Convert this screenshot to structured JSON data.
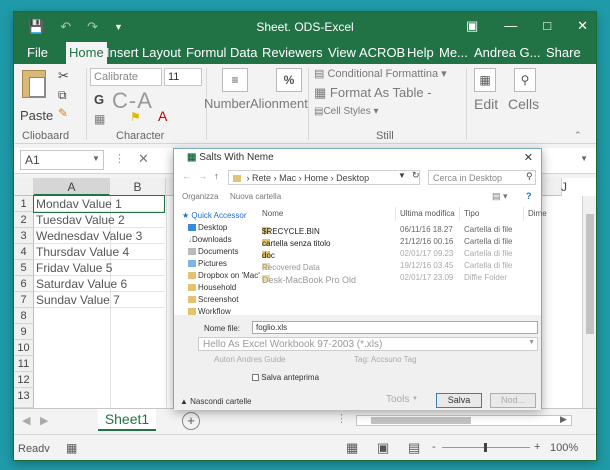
{
  "window": {
    "title": "Sheet. ODS-Excel",
    "qat_icons": [
      "save-icon",
      "undo-icon",
      "redo-icon",
      "customize-icon"
    ],
    "controls": [
      "ribbon-display-icon",
      "minimize-icon",
      "maximize-icon",
      "close-icon"
    ]
  },
  "tabs": [
    "File",
    "Home",
    "Insert",
    "Layout",
    "Formul",
    "Data",
    "Reviewers",
    "View",
    "ACROB",
    "Help",
    "Me...",
    "Andrea G...",
    "Share"
  ],
  "ribbon": {
    "paste": "Paste",
    "clipboard": "Cliobaard",
    "font_name": "Calibrate",
    "font_size": "11",
    "bold": "G",
    "caa": "C-A",
    "character": "Character",
    "number": "Number",
    "alignment": "Alionment",
    "percent": "%",
    "conditional": "Conditional Formattina",
    "format_table": "Format As Table -",
    "cell_styles": "Cell Styles",
    "still": "Still",
    "edit": "Edit",
    "cells": "Cells"
  },
  "formula": {
    "name_box": "A1"
  },
  "columns": [
    "A",
    "B",
    "J"
  ],
  "rows": [
    "1",
    "2",
    "3",
    "4",
    "5",
    "6",
    "7",
    "8",
    "9",
    "10",
    "11",
    "12",
    "13"
  ],
  "cells": [
    "Mondav Value 1",
    "Tuesdav Value 2",
    "Wednesdav Value 3",
    "Thursdav Value 4",
    "Fridav Value 5",
    "Saturdav Value 6",
    "Sundav Value 7"
  ],
  "sheet": {
    "tab": "Sheet1",
    "add": "+"
  },
  "status": {
    "ready": "Readv",
    "zoom": "100%",
    "minus": "-",
    "plus": "+"
  },
  "dialog": {
    "title": "Salts With Neme",
    "path": [
      "Rete",
      "Mac",
      "Home",
      "Desktop"
    ],
    "search": "Cerca in Desktop",
    "organize": "Organizza",
    "new_folder": "Nuova cartella",
    "sidebar": [
      "Quick Accessor",
      "Desktop",
      "Downloads",
      "Documents",
      "Pictures",
      "Dropbox on 'Mac'",
      "Household",
      "Screenshot",
      "Workflow"
    ],
    "headers": [
      "Nome",
      "Ultima modifica",
      "Tipo",
      "Dime"
    ],
    "files": [
      {
        "name": "$RECYCLE.BIN",
        "date": "06/11/16 18.27",
        "type": "Cartella di file"
      },
      {
        "name": "cartella senza titolo",
        "date": "21/12/16 00.16",
        "type": "Cartella di file"
      },
      {
        "name": "doc",
        "date": "02/01/17 09.23",
        "type": "Cartella di file"
      },
      {
        "name": "Recovered Data",
        "date": "19/12/16 03.45",
        "type": "Cartella di file"
      },
      {
        "name": "Desk-MacBook Pro Old",
        "date": "02/01/17 23.09",
        "type": "Diffie Folder"
      }
    ],
    "filename_label": "Nome file:",
    "filename": "foglio.xls",
    "filetype": "Hello As Excel Workbook 97-2003 (*.xls)",
    "authors": "Autori Andres Guide",
    "tags": "Tag: Accsuno Tag",
    "thumbnail": "Salva anteprima",
    "hide": "Nascondi cartelle",
    "tools": "Tools",
    "save": "Salva",
    "cancel": "Nod..."
  }
}
